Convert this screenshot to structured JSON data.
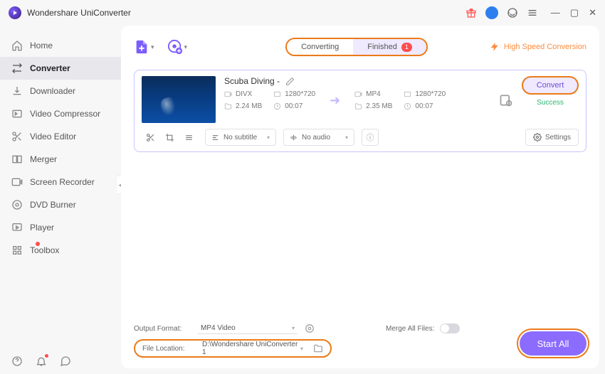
{
  "app": {
    "title": "Wondershare UniConverter"
  },
  "sidebar": {
    "items": [
      {
        "label": "Home"
      },
      {
        "label": "Converter"
      },
      {
        "label": "Downloader"
      },
      {
        "label": "Video Compressor"
      },
      {
        "label": "Video Editor"
      },
      {
        "label": "Merger"
      },
      {
        "label": "Screen Recorder"
      },
      {
        "label": "DVD Burner"
      },
      {
        "label": "Player"
      },
      {
        "label": "Toolbox"
      }
    ]
  },
  "tabs": {
    "converting": "Converting",
    "finished": "Finished",
    "badge": "1"
  },
  "hsc": "High Speed Conversion",
  "file": {
    "name": "Scuba Diving -",
    "src": {
      "format": "DIVX",
      "res": "1280*720",
      "size": "2.24 MB",
      "dur": "00:07"
    },
    "dst": {
      "format": "MP4",
      "res": "1280*720",
      "size": "2.35 MB",
      "dur": "00:07"
    },
    "subtitle": "No subtitle",
    "audio": "No audio",
    "settings": "Settings",
    "convert": "Convert",
    "status": "Success"
  },
  "footer": {
    "output_format_label": "Output Format:",
    "output_format": "MP4 Video",
    "file_location_label": "File Location:",
    "file_location": "D:\\Wondershare UniConverter 1",
    "merge_label": "Merge All Files:",
    "start_all": "Start All"
  }
}
